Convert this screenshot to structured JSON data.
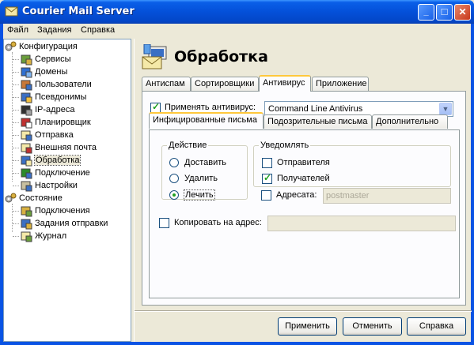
{
  "window": {
    "title": "Courier Mail Server",
    "controls": {
      "minimize": "_",
      "maximize": "□",
      "close": "✕"
    }
  },
  "menu": [
    "Файл",
    "Задания",
    "Справка"
  ],
  "tree": {
    "config_label": "Конфигурация",
    "config_items": [
      {
        "label": "Сервисы",
        "icon": "services-icon"
      },
      {
        "label": "Домены",
        "icon": "domains-icon"
      },
      {
        "label": "Пользователи",
        "icon": "users-icon"
      },
      {
        "label": "Псевдонимы",
        "icon": "aliases-icon"
      },
      {
        "label": "IP-адреса",
        "icon": "ip-icon"
      },
      {
        "label": "Планировщик",
        "icon": "scheduler-icon"
      },
      {
        "label": "Отправка",
        "icon": "sending-icon"
      },
      {
        "label": "Внешняя почта",
        "icon": "external-mail-icon"
      },
      {
        "label": "Обработка",
        "icon": "processing-icon"
      },
      {
        "label": "Подключение",
        "icon": "connection-icon"
      },
      {
        "label": "Настройки",
        "icon": "settings-icon"
      }
    ],
    "status_label": "Состояние",
    "status_items": [
      {
        "label": "Подключения",
        "icon": "connections-icon"
      },
      {
        "label": "Задания отправки",
        "icon": "send-jobs-icon"
      },
      {
        "label": "Журнал",
        "icon": "log-icon"
      }
    ],
    "selected": "Обработка"
  },
  "header": {
    "title": "Обработка"
  },
  "tabs": [
    "Антиспам",
    "Сортировщики",
    "Антивирус",
    "Приложение"
  ],
  "active_tab": "Антивирус",
  "antivirus": {
    "apply_label": "Применять антивирус:",
    "apply_checked": true,
    "engine_value": "Command Line Antivirus",
    "subtabs": [
      "Инфицированные письма",
      "Подозрительные письма",
      "Дополнительно"
    ],
    "active_subtab": "Инфицированные письма",
    "action": {
      "legend": "Действие",
      "options": [
        "Доставить",
        "Удалить",
        "Лечить"
      ],
      "selected": "Лечить"
    },
    "notify": {
      "legend": "Уведомлять",
      "sender_label": "Отправителя",
      "sender_checked": false,
      "recipients_label": "Получателей",
      "recipients_checked": true,
      "addressee_label": "Адресата:",
      "addressee_checked": false,
      "addressee_placeholder": "postmaster"
    },
    "copy_label": "Копировать на адрес:",
    "copy_checked": false,
    "copy_value": ""
  },
  "buttons": {
    "apply": "Применить",
    "cancel": "Отменить",
    "help": "Справка"
  }
}
